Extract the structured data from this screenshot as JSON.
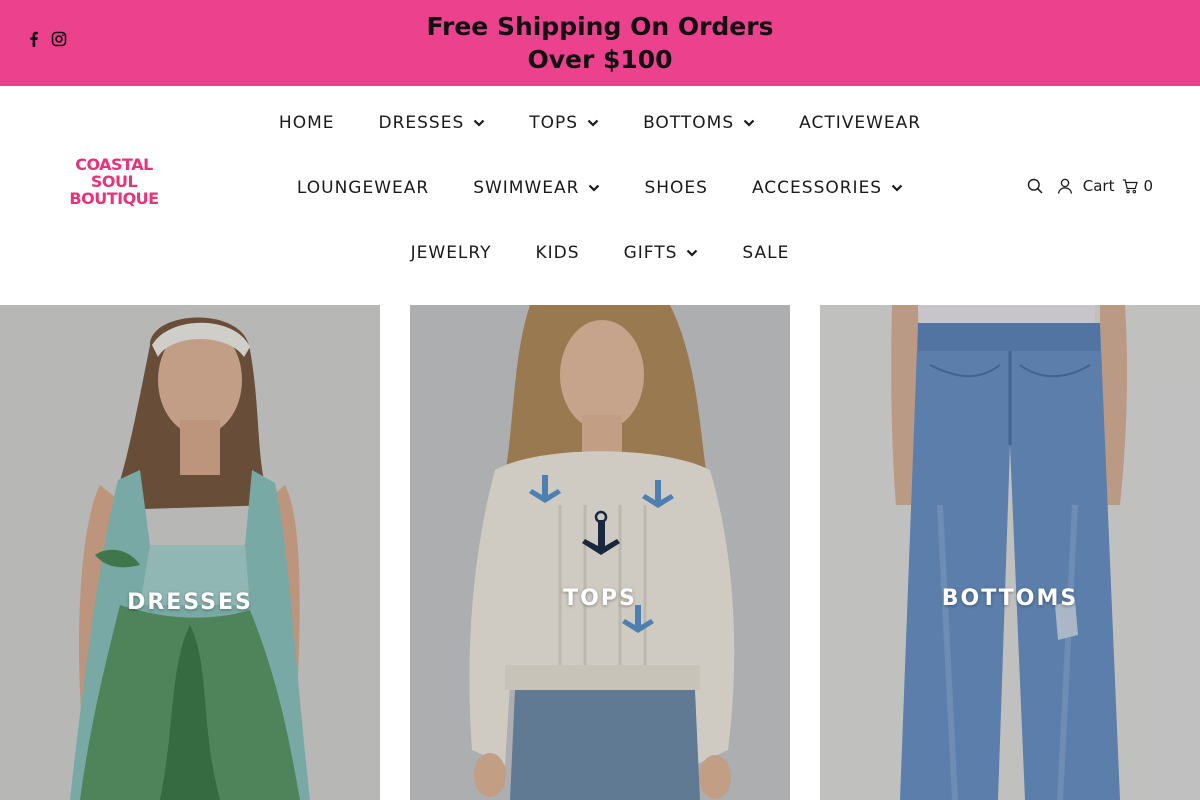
{
  "announcement": {
    "line1": "Free Shipping On Orders",
    "line2": "Over $100",
    "background": "#ec418d",
    "social_icons": [
      "facebook-icon",
      "instagram-icon"
    ]
  },
  "brand": {
    "logo_line1": "COASTAL",
    "logo_line2": "SOUL",
    "logo_line3": "BOUTIQUE",
    "color": "#e8327a"
  },
  "nav": {
    "row1": [
      {
        "label": "HOME",
        "dropdown": false
      },
      {
        "label": "DRESSES",
        "dropdown": true
      },
      {
        "label": "TOPS",
        "dropdown": true
      },
      {
        "label": "BOTTOMS",
        "dropdown": true
      },
      {
        "label": "ACTIVEWEAR",
        "dropdown": false
      }
    ],
    "row2": [
      {
        "label": "LOUNGEWEAR",
        "dropdown": false
      },
      {
        "label": "SWIMWEAR",
        "dropdown": true
      },
      {
        "label": "SHOES",
        "dropdown": false
      },
      {
        "label": "ACCESSORIES",
        "dropdown": true
      }
    ],
    "row3": [
      {
        "label": "JEWELRY",
        "dropdown": false
      },
      {
        "label": "KIDS",
        "dropdown": false
      },
      {
        "label": "GIFTS",
        "dropdown": true
      },
      {
        "label": "SALE",
        "dropdown": false
      }
    ]
  },
  "utility": {
    "cart_label": "Cart",
    "cart_count": "0",
    "icons": [
      "search-icon",
      "account-icon",
      "cart-icon"
    ]
  },
  "collections": [
    {
      "label": "DRESSES"
    },
    {
      "label": "TOPS"
    },
    {
      "label": "BOTTOMS"
    }
  ]
}
